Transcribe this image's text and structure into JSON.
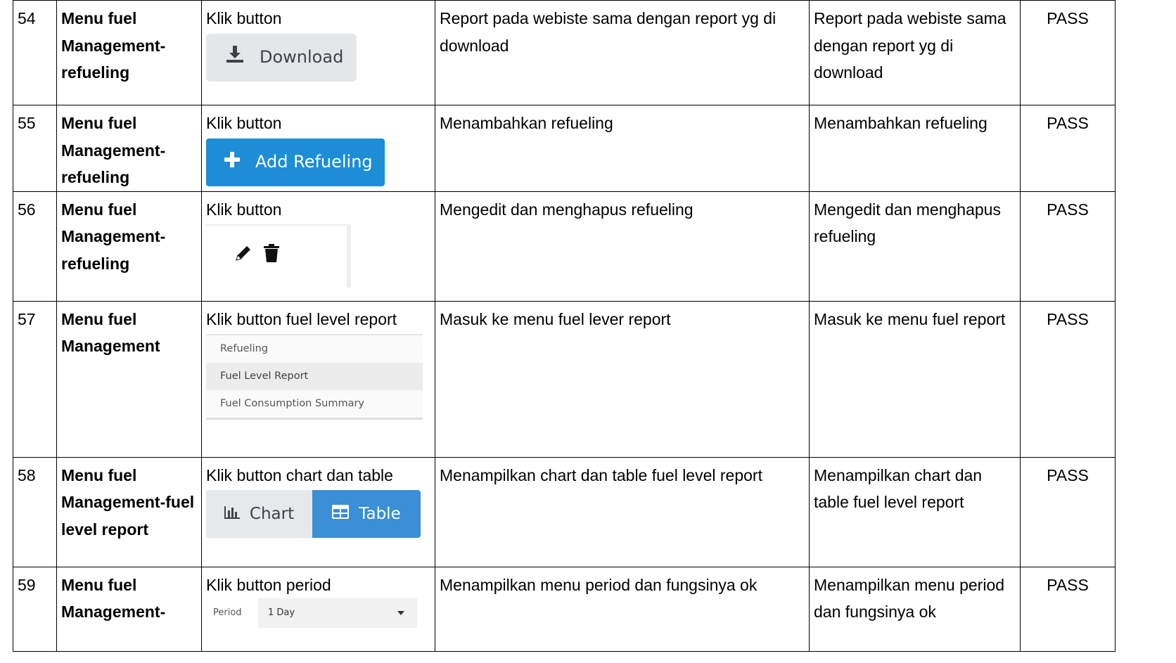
{
  "rows": [
    {
      "no": "54",
      "module": "Menu fuel Management-refueling",
      "step": "Klik button",
      "expected": "Report pada webiste sama dengan report yg di download",
      "actual": "Report pada webiste sama dengan report yg di download",
      "status": "PASS",
      "mock": {
        "download_label": "Download",
        "icon": "download-icon"
      }
    },
    {
      "no": "55",
      "module": "Menu fuel Management-refueling",
      "step": "Klik button",
      "expected": "Menambahkan refueling",
      "actual": "Menambahkan refueling",
      "status": "PASS",
      "mock": {
        "add_label": "Add Refueling",
        "icon": "plus-icon"
      }
    },
    {
      "no": "56",
      "module": "Menu fuel Management-refueling",
      "step": "Klik button",
      "expected": "Mengedit dan menghapus refueling",
      "actual": "Mengedit dan menghapus refueling",
      "status": "PASS",
      "mock": {
        "icons": [
          "pencil-icon",
          "trash-icon"
        ]
      }
    },
    {
      "no": "57",
      "module": "Menu fuel Management",
      "step": "Klik button fuel level report",
      "expected": "Masuk ke menu fuel lever report",
      "actual": "Masuk ke menu fuel report",
      "status": "PASS",
      "mock": {
        "menu_items": [
          "Refueling",
          "Fuel Level Report",
          "Fuel Consumption Summary"
        ],
        "active_item": "Fuel Level Report"
      }
    },
    {
      "no": "58",
      "module": "Menu fuel Management-fuel level report",
      "step": "Klik button chart dan table",
      "expected": "Menampilkan chart dan table fuel level report",
      "actual": "Menampilkan chart dan table fuel level report",
      "status": "PASS",
      "mock": {
        "chart_label": "Chart",
        "table_label": "Table",
        "selected": "Table"
      }
    },
    {
      "no": "59",
      "module": "Menu fuel Management-",
      "step": "Klik button period",
      "expected": "Menampilkan menu period dan fungsinya ok",
      "actual": "Menampilkan menu period dan fungsinya ok",
      "status": "PASS",
      "mock": {
        "period_label": "Period",
        "period_value": "1 Day"
      }
    }
  ],
  "colors": {
    "add_button": "#1d8dd6",
    "table_toggle": "#3a8fd6",
    "neutral_button": "#e4e6ea"
  }
}
